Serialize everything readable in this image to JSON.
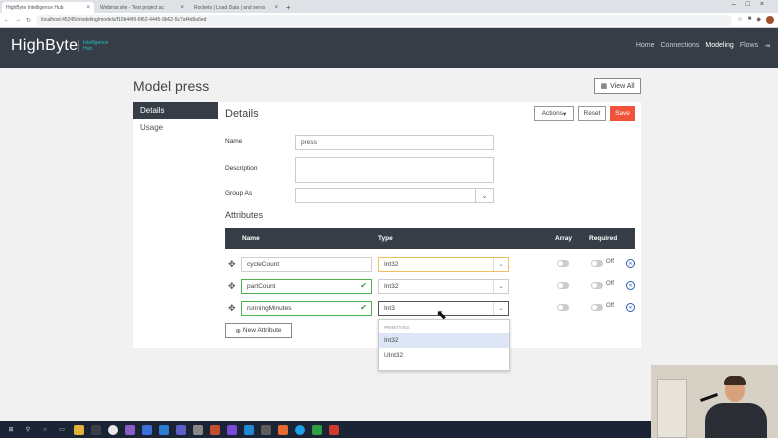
{
  "browser": {
    "tabs": [
      {
        "label": "HighByte Intelligence Hub",
        "active": true
      },
      {
        "label": "Webinar.site - Test project ac",
        "active": false
      },
      {
        "label": "Rockets | Load Data | and servo",
        "active": false
      }
    ],
    "new_tab": "+",
    "url": "localhost:45245/modeling/models/f10b44f9-6f62-4445-9b62-5c7af4d9a6ed"
  },
  "app": {
    "logo": "HighByte",
    "logo_sub": "Intelligence Hub",
    "nav": [
      "Home",
      "Connections",
      "Modeling",
      "Flows"
    ],
    "nav_current": "Modeling",
    "logout_icon": "logout-icon"
  },
  "page": {
    "title": "Model press",
    "view_all": "View All"
  },
  "sidebar": {
    "items": [
      {
        "label": "Details",
        "selected": true
      },
      {
        "label": "Usage",
        "selected": false
      }
    ]
  },
  "details": {
    "title": "Details",
    "actions": "Actions",
    "reset": "Reset",
    "save": "Save",
    "name_label": "Name",
    "name_value": "press",
    "description_label": "Description",
    "description_value": "",
    "group_label": "Group As",
    "group_value": ""
  },
  "attributes": {
    "title": "Attributes",
    "headers": {
      "name": "Name",
      "type": "Type",
      "array": "Array",
      "required": "Required"
    },
    "rows": [
      {
        "name": "cycleCount",
        "type": "Int32",
        "array": "",
        "required": "Off"
      },
      {
        "name": "partCount",
        "type": "Int32",
        "array": "",
        "required": "Off"
      },
      {
        "name": "runningMinutes",
        "type": "Int3",
        "array": "",
        "required": "Off"
      }
    ],
    "new_attribute": "New Attribute"
  },
  "dropdown": {
    "group": "PRIMITIVES",
    "options": [
      "Int32",
      "UInt32"
    ],
    "highlighted": "Int32"
  },
  "colors": {
    "nav_bg": "#363d47",
    "accent": "#1ec3c3",
    "save": "#f0533a"
  }
}
